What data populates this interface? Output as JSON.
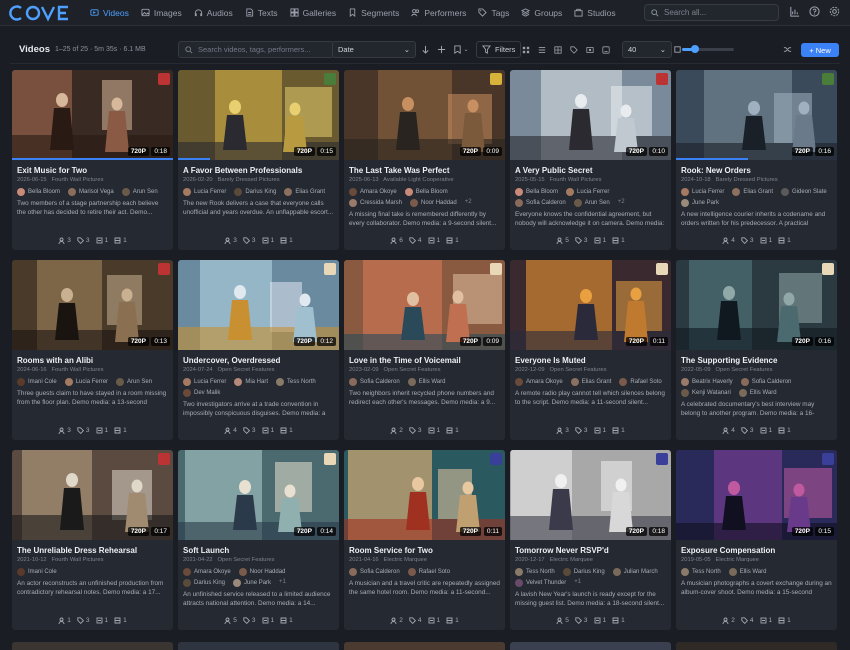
{
  "app": {
    "name": "COVE",
    "logo_color": "#4ea0ff"
  },
  "nav": {
    "items": [
      {
        "label": "Videos",
        "icon": "video-icon",
        "active": true
      },
      {
        "label": "Images",
        "icon": "image-icon"
      },
      {
        "label": "Audios",
        "icon": "headphones-icon"
      },
      {
        "label": "Texts",
        "icon": "document-icon"
      },
      {
        "label": "Galleries",
        "icon": "gallery-icon"
      },
      {
        "label": "Segments",
        "icon": "bookmark-icon"
      },
      {
        "label": "Performers",
        "icon": "people-icon"
      },
      {
        "label": "Tags",
        "icon": "tag-icon"
      },
      {
        "label": "Groups",
        "icon": "layers-icon"
      },
      {
        "label": "Studios",
        "icon": "studio-icon"
      }
    ],
    "search_placeholder": "Search all..."
  },
  "toolbar": {
    "title": "Videos",
    "count": "1–25 of 25 · 5m 35s · 6.1 MB",
    "search_placeholder": "Search videos, tags, performers...",
    "sort_value": "Date",
    "filters_label": "Filters",
    "per_page": "40",
    "zoom_level": 0.25,
    "new_label": "+ New"
  },
  "colors": {
    "accent": "#3b82f6",
    "background": "#1a1d23",
    "card": "#252931"
  },
  "videos": [
    {
      "title": "Exit Music for Two",
      "date": "2026-06-15",
      "studio": "Fourth Wall Pictures",
      "resolution": "720P",
      "duration": "0:18",
      "progress": 1.0,
      "people": [
        [
          "Bella Bloom",
          "#c98a7a"
        ],
        [
          "Marisol Vega",
          "#8a6d5a"
        ],
        [
          "Arun Sen",
          "#6a5a4a"
        ]
      ],
      "more": "",
      "description": "Two members of a stage partnership each believe the other has decided to retire their act. Demo...",
      "stats": [
        "3",
        "3",
        "1",
        "1"
      ],
      "badge_color": "#b33"
    },
    {
      "title": "A Favor Between Professionals",
      "date": "2026-02-20",
      "studio": "Barely Dressed Pictures",
      "resolution": "720P",
      "duration": "0:15",
      "progress": 0.2,
      "people": [
        [
          "Lucia Ferrer",
          "#a57a62"
        ],
        [
          "Darius King",
          "#5a4a3a"
        ],
        [
          "Elias Grant",
          "#8a7060"
        ]
      ],
      "more": "",
      "description": "The new Rook delivers a case that everyone calls unofficial and years overdue. An unflappable escort...",
      "stats": [
        "3",
        "3",
        "1",
        "1"
      ],
      "badge_color": "#4a7d3a"
    },
    {
      "title": "The Last Take Was Perfect",
      "date": "2025-06-13",
      "studio": "Available Light Cooperative",
      "resolution": "720P",
      "duration": "0:09",
      "progress": 0.0,
      "people": [
        [
          "Amara Okoye",
          "#6a4a3a"
        ],
        [
          "Bella Bloom",
          "#c98a7a"
        ],
        [
          "Cressida Marsh",
          "#9a7a6a"
        ],
        [
          "Noor Haddad",
          "#7a5a4a"
        ]
      ],
      "more": "+2",
      "description": "A missing final take is remembered differently by every collaborator. Demo media: a 9-second silent...",
      "stats": [
        "6",
        "4",
        "1",
        "1"
      ],
      "badge_color": "#d6b23a"
    },
    {
      "title": "A Very Public Secret",
      "date": "2025-05-15",
      "studio": "Fourth Wall Pictures",
      "resolution": "720P",
      "duration": "0:10",
      "progress": 0.0,
      "people": [
        [
          "Bella Bloom",
          "#c98a7a"
        ],
        [
          "Lucia Ferrer",
          "#a57a62"
        ],
        [
          "Sofia Calderon",
          "#8a6a5a"
        ],
        [
          "Arun Sen",
          "#6a5a4a"
        ]
      ],
      "more": "+2",
      "description": "Everyone knows the confidential agreement, but nobody will acknowledge it on camera. Demo media: a...",
      "stats": [
        "5",
        "3",
        "1",
        "1"
      ],
      "badge_color": "#b33"
    },
    {
      "title": "Rook: New Orders",
      "date": "2024-10-18",
      "studio": "Barely Dressed Pictures",
      "resolution": "720P",
      "duration": "0:16",
      "progress": 0.45,
      "people": [
        [
          "Lucia Ferrer",
          "#a57a62"
        ],
        [
          "Elias Grant",
          "#8a7060"
        ],
        [
          "Gideon Slate",
          "#5a5a5a"
        ],
        [
          "June Park",
          "#9a8a7a"
        ]
      ],
      "more": "",
      "description": "A new intelligence courier inherits a codename and orders written for his predecessor. A practical escort...",
      "stats": [
        "4",
        "3",
        "1",
        "1"
      ],
      "badge_color": "#4a7d3a"
    },
    {
      "title": "Rooms with an Alibi",
      "date": "2024-06-16",
      "studio": "Fourth Wall Pictures",
      "resolution": "720P",
      "duration": "0:13",
      "progress": 0.0,
      "people": [
        [
          "Imani Cole",
          "#5a3a2a"
        ],
        [
          "Lucia Ferrer",
          "#a57a62"
        ],
        [
          "Arun Sen",
          "#6a5a4a"
        ]
      ],
      "more": "",
      "description": "Three guests claim to have stayed in a room missing from the floor plan. Demo media: a 13-second silent...",
      "stats": [
        "3",
        "3",
        "1",
        "1"
      ],
      "badge_color": "#b33"
    },
    {
      "title": "Undercover, Overdressed",
      "date": "2024-07-24",
      "studio": "Open Secret Features",
      "resolution": "720P",
      "duration": "0:12",
      "progress": 0.0,
      "people": [
        [
          "Lucia Ferrer",
          "#a57a62"
        ],
        [
          "Mia Hart",
          "#b58a7a"
        ],
        [
          "Tess North",
          "#8a7a6a"
        ],
        [
          "Dev Malik",
          "#6a4a3a"
        ]
      ],
      "more": "",
      "description": "Two investigators arrive at a trade convention in impossibly conspicuous disguises. Demo media: a 12...",
      "stats": [
        "4",
        "3",
        "1",
        "1"
      ],
      "badge_color": "#e8d8b8"
    },
    {
      "title": "Love in the Time of Voicemail",
      "date": "2023-02-09",
      "studio": "Open Secret Features",
      "resolution": "720P",
      "duration": "0:09",
      "progress": 0.0,
      "people": [
        [
          "Sofia Calderon",
          "#8a6a5a"
        ],
        [
          "Ellis Ward",
          "#7a6a5a"
        ]
      ],
      "more": "",
      "description": "Two neighbors inherit recycled phone numbers and redirect each other's messages. Demo media: a 9...",
      "stats": [
        "2",
        "3",
        "1",
        "1"
      ],
      "badge_color": "#e8d8b8"
    },
    {
      "title": "Everyone Is Muted",
      "date": "2022-12-09",
      "studio": "Open Secret Features",
      "resolution": "720P",
      "duration": "0:11",
      "progress": 0.0,
      "people": [
        [
          "Amara Okoye",
          "#6a4a3a"
        ],
        [
          "Elias Grant",
          "#8a7060"
        ],
        [
          "Rafael Soto",
          "#7a5a4a"
        ]
      ],
      "more": "",
      "description": "A remote radio play cannot tell which silences belong to the script. Demo media: a 11-second silent...",
      "stats": [
        "3",
        "3",
        "1",
        "1"
      ],
      "badge_color": "#e8d8b8"
    },
    {
      "title": "The Supporting Evidence",
      "date": "2022-05-09",
      "studio": "Open Secret Features",
      "resolution": "720P",
      "duration": "0:16",
      "progress": 0.0,
      "people": [
        [
          "Beatrix Haverly",
          "#9a7a6a"
        ],
        [
          "Sofia Calderon",
          "#8a6a5a"
        ],
        [
          "Kenji Watanari",
          "#6a5a4a"
        ],
        [
          "Ellis Ward",
          "#7a6a5a"
        ]
      ],
      "more": "",
      "description": "A celebrated documentary's best interview may belong to another program. Demo media: a 16-second...",
      "stats": [
        "4",
        "3",
        "1",
        "1"
      ],
      "badge_color": "#e8d8b8"
    },
    {
      "title": "The Unreliable Dress Rehearsal",
      "date": "2021-10-12",
      "studio": "Fourth Wall Pictures",
      "resolution": "720P",
      "duration": "0:17",
      "progress": 0.0,
      "people": [
        [
          "Imani Cole",
          "#5a3a2a"
        ]
      ],
      "more": "",
      "description": "An actor reconstructs an unfinished production from contradictory rehearsal notes. Demo media: a 17...",
      "stats": [
        "1",
        "3",
        "1",
        "1"
      ],
      "badge_color": "#b33"
    },
    {
      "title": "Soft Launch",
      "date": "2021-04-22",
      "studio": "Open Secret Features",
      "resolution": "720P",
      "duration": "0:14",
      "progress": 0.0,
      "people": [
        [
          "Amara Okoye",
          "#6a4a3a"
        ],
        [
          "Noor Haddad",
          "#7a5a4a"
        ],
        [
          "Darius King",
          "#5a4a3a"
        ],
        [
          "June Park",
          "#9a8a7a"
        ]
      ],
      "more": "+1",
      "description": "An unfinished service released to a limited audience attracts national attention. Demo media: a 14...",
      "stats": [
        "5",
        "3",
        "1",
        "1"
      ],
      "badge_color": "#e8d8b8"
    },
    {
      "title": "Room Service for Two",
      "date": "2021-04-16",
      "studio": "Electric Marquee",
      "resolution": "720P",
      "duration": "0:11",
      "progress": 0.0,
      "people": [
        [
          "Sofia Calderon",
          "#8a6a5a"
        ],
        [
          "Rafael Soto",
          "#7a5a4a"
        ]
      ],
      "more": "",
      "description": "A musician and a travel critic are repeatedly assigned the same hotel room. Demo media: a 11-second...",
      "stats": [
        "2",
        "4",
        "1",
        "1"
      ],
      "badge_color": "#3a3f9a"
    },
    {
      "title": "Tomorrow Never RSVP'd",
      "date": "2020-12-17",
      "studio": "Electric Marquee",
      "resolution": "720P",
      "duration": "0:18",
      "progress": 0.0,
      "people": [
        [
          "Tess North",
          "#8a7a6a"
        ],
        [
          "Darius King",
          "#5a4a3a"
        ],
        [
          "Julian March",
          "#7a6a5a"
        ],
        [
          "Velvet Thunder",
          "#6a4a6a"
        ]
      ],
      "more": "+1",
      "description": "A lavish New Year's launch is ready except for the missing guest list. Demo media: a 18-second silent...",
      "stats": [
        "5",
        "3",
        "1",
        "1"
      ],
      "badge_color": "#3a3f9a"
    },
    {
      "title": "Exposure Compensation",
      "date": "2019-05-05",
      "studio": "Electric Marquee",
      "resolution": "720P",
      "duration": "0:15",
      "progress": 0.0,
      "people": [
        [
          "Tess North",
          "#8a7a6a"
        ],
        [
          "Ellis Ward",
          "#7a6a5a"
        ]
      ],
      "more": "",
      "description": "A musician photographs a covert exchange during an album-cover shoot. Demo media: a 15-second silent...",
      "stats": [
        "2",
        "4",
        "1",
        "1"
      ],
      "badge_color": "#3a3f9a"
    }
  ]
}
